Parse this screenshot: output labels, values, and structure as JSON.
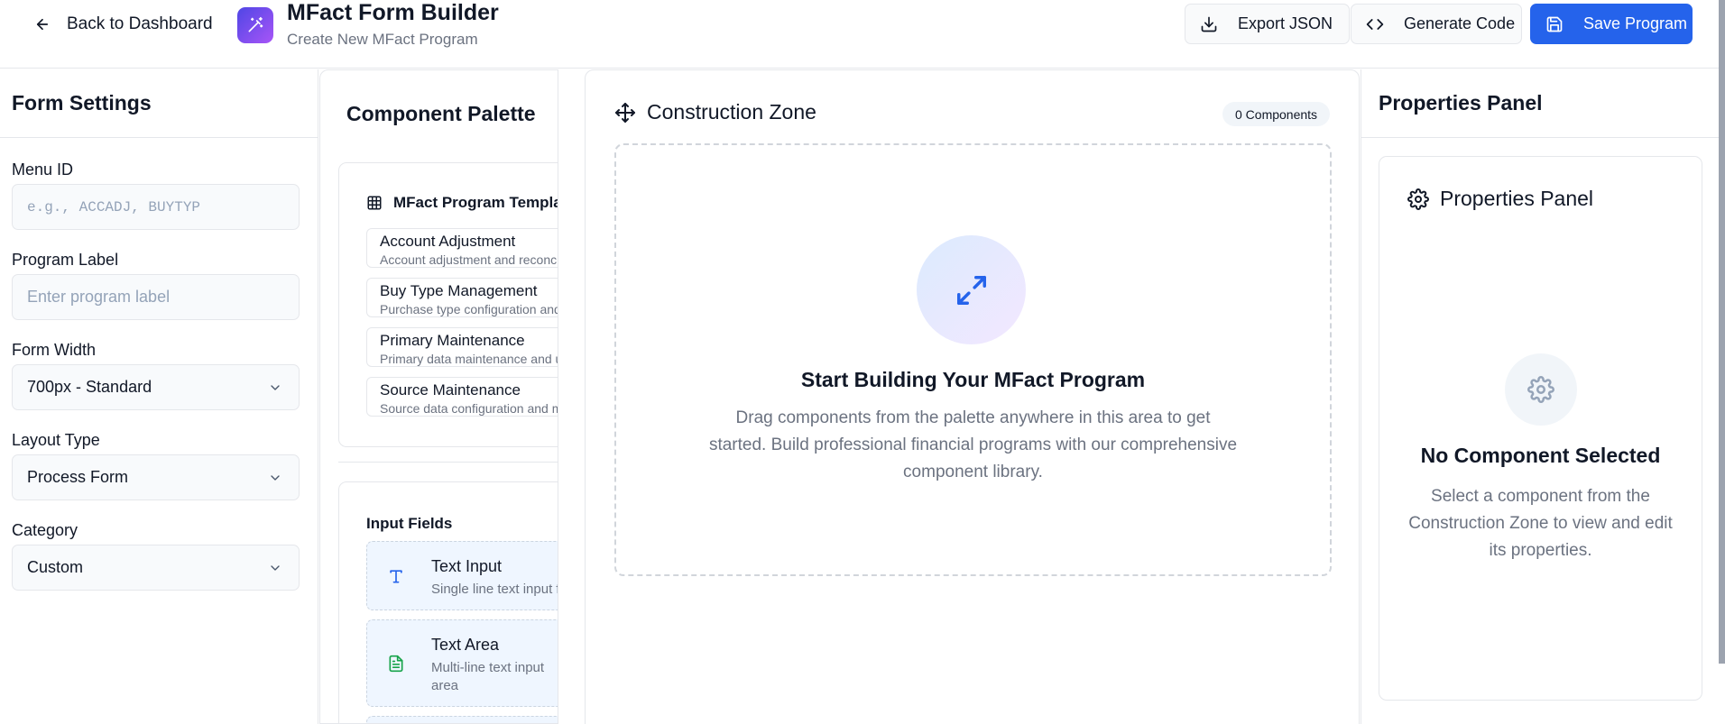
{
  "header": {
    "back_label": "Back to Dashboard",
    "title": "MFact Form Builder",
    "subtitle": "Create New MFact Program",
    "export_label": "Export JSON",
    "generate_label": "Generate Code",
    "save_label": "Save Program",
    "accent_color": "#2563eb"
  },
  "form_settings": {
    "title": "Form Settings",
    "menu_id": {
      "label": "Menu ID",
      "placeholder": "e.g., ACCADJ, BUYTYP"
    },
    "program_label": {
      "label": "Program Label",
      "placeholder": "Enter program label"
    },
    "form_width": {
      "label": "Form Width",
      "value": "700px - Standard"
    },
    "layout_type": {
      "label": "Layout Type",
      "value": "Process Form"
    },
    "category": {
      "label": "Category",
      "value": "Custom"
    }
  },
  "palette": {
    "title": "Component Palette",
    "templates_title": "MFact Program Templates",
    "templates": [
      {
        "name": "Account Adjustment",
        "desc": "Account adjustment and reconciliation"
      },
      {
        "name": "Buy Type Management",
        "desc": "Purchase type configuration and setup"
      },
      {
        "name": "Primary Maintenance",
        "desc": "Primary data maintenance and updates"
      },
      {
        "name": "Source Maintenance",
        "desc": "Source data configuration and management"
      }
    ],
    "input_fields_title": "Input Fields",
    "components": [
      {
        "name": "Text Input",
        "desc": "Single line text input field",
        "icon": "text-icon"
      },
      {
        "name": "Text Area",
        "desc": "Multi-line text input area",
        "icon": "document-icon"
      }
    ]
  },
  "zone": {
    "title": "Construction Zone",
    "badge": "0 Components",
    "empty_title": "Start Building Your MFact Program",
    "empty_text": "Drag components from the palette anywhere in this area to get started. Build professional financial programs with our comprehensive component library."
  },
  "properties": {
    "title": "Properties Panel",
    "card_title": "Properties Panel",
    "empty_title": "No Component Selected",
    "empty_text": "Select a component from the Construction Zone to view and edit its properties."
  }
}
